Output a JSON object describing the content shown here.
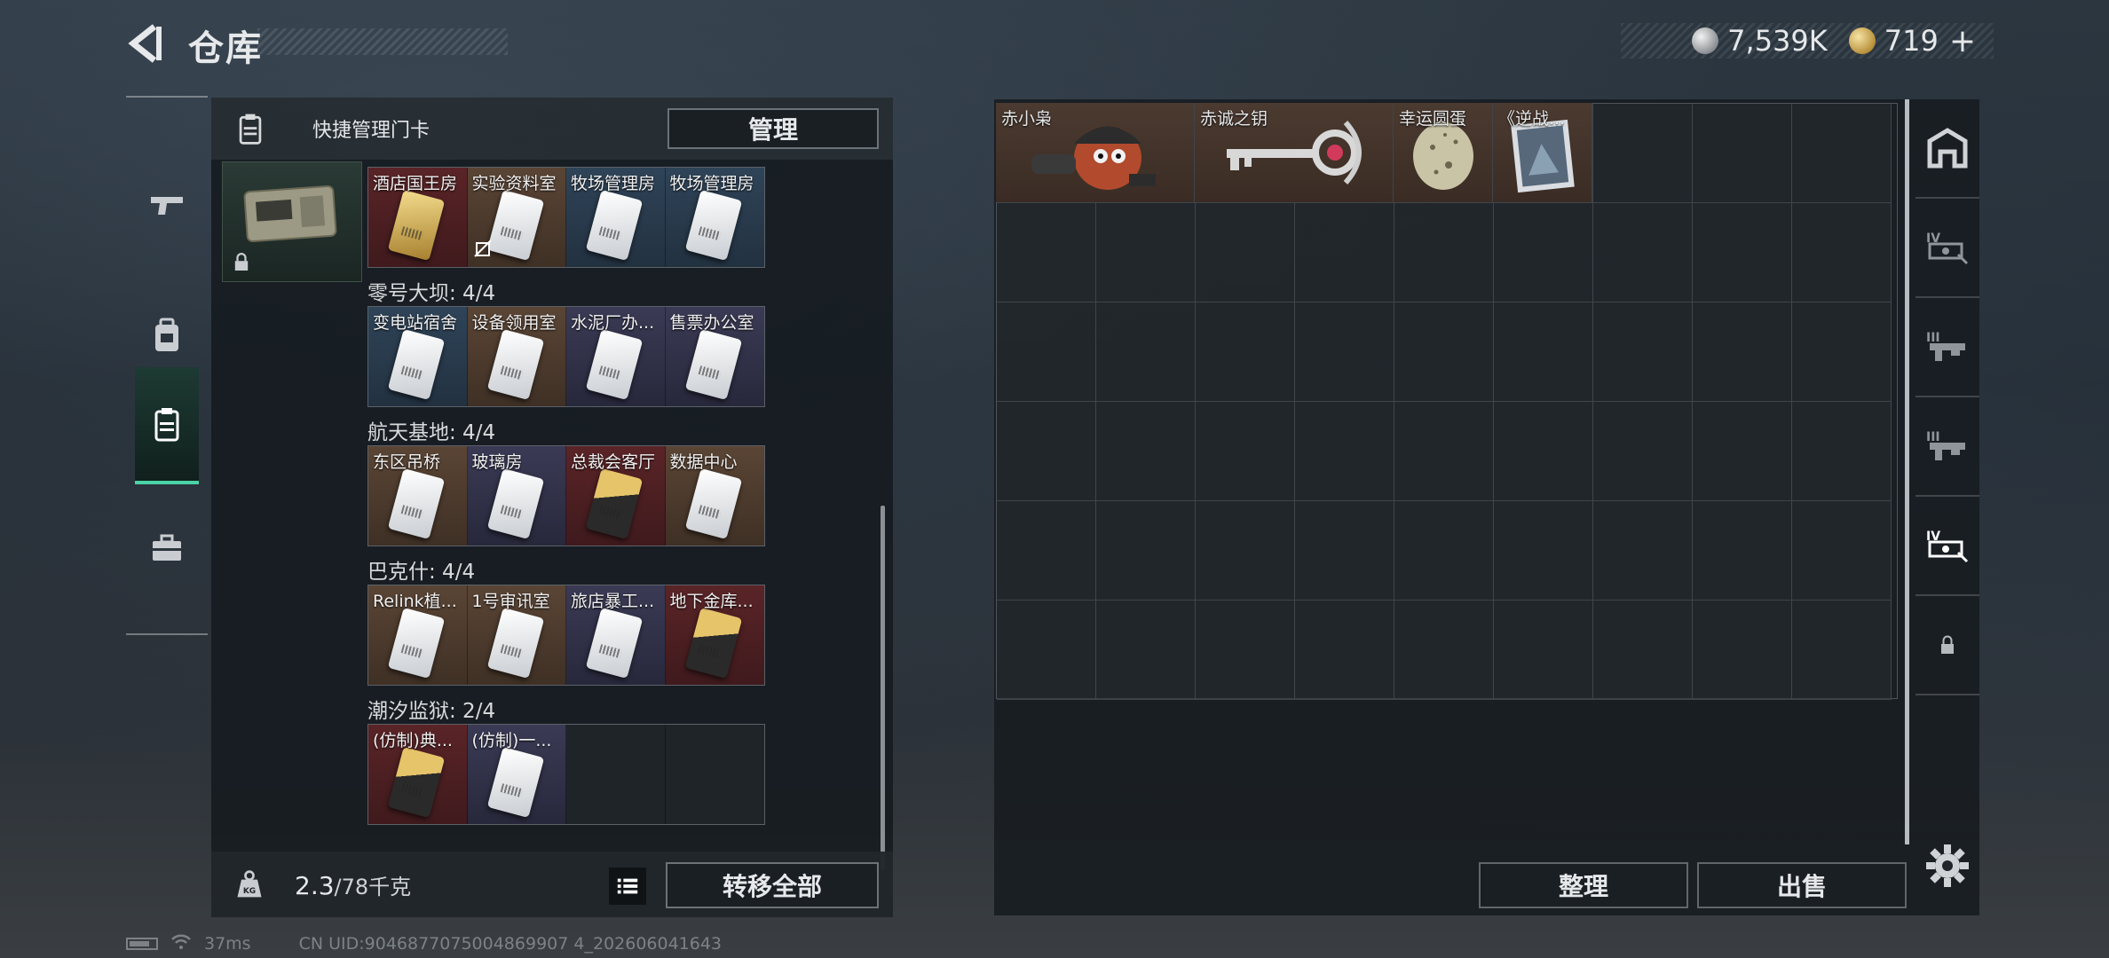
{
  "header": {
    "title": "仓库",
    "back_icon": "back-arrow-icon"
  },
  "currency": {
    "silver_amount": "7,539K",
    "gold_amount": "719",
    "plus": "+"
  },
  "left_tabs": [
    {
      "name": "weapons",
      "icon": "gun-icon",
      "active": false
    },
    {
      "name": "armor",
      "icon": "backpack-icon",
      "active": false
    },
    {
      "name": "keycards",
      "icon": "keycard-holder-icon",
      "active": true
    },
    {
      "name": "toolbox",
      "icon": "briefcase-icon",
      "active": false
    }
  ],
  "keypanel": {
    "header_label": "快捷管理门卡",
    "manage_label": "管理",
    "groups": [
      {
        "title": "",
        "cards": [
          {
            "name": "酒店国王房",
            "color": "red",
            "card": "gold",
            "nolink": false
          },
          {
            "name": "实验资料室",
            "color": "brown",
            "card": "white",
            "nolink": true
          },
          {
            "name": "牧场管理房",
            "color": "blue",
            "card": "white",
            "nolink": false
          },
          {
            "name": "牧场管理房",
            "color": "blue",
            "card": "white",
            "nolink": false
          }
        ]
      },
      {
        "title": "零号大坝: 4/4",
        "cards": [
          {
            "name": "变电站宿舍",
            "color": "blue",
            "card": "white",
            "nolink": false
          },
          {
            "name": "设备领用室",
            "color": "brown",
            "card": "white",
            "nolink": false
          },
          {
            "name": "水泥厂办...",
            "color": "purple",
            "card": "white",
            "nolink": false
          },
          {
            "name": "售票办公室",
            "color": "purple",
            "card": "white",
            "nolink": false
          }
        ]
      },
      {
        "title": "航天基地: 4/4",
        "cards": [
          {
            "name": "东区吊桥",
            "color": "brown",
            "card": "white",
            "nolink": false
          },
          {
            "name": "玻璃房",
            "color": "purple",
            "card": "white",
            "nolink": false
          },
          {
            "name": "总裁会客厅",
            "color": "red",
            "card": "blackgold",
            "nolink": false
          },
          {
            "name": "数据中心",
            "color": "brown",
            "card": "white",
            "nolink": false
          }
        ]
      },
      {
        "title": "巴克什: 4/4",
        "cards": [
          {
            "name": "Relink植...",
            "color": "brown",
            "card": "white",
            "nolink": false
          },
          {
            "name": "1号审讯室",
            "color": "brown",
            "card": "white",
            "nolink": false
          },
          {
            "name": "旅店暴工...",
            "color": "purple",
            "card": "white",
            "nolink": false
          },
          {
            "name": "地下金库...",
            "color": "red",
            "card": "blackgold",
            "nolink": false
          }
        ]
      },
      {
        "title": "潮汐监狱: 2/4",
        "cards": [
          {
            "name": "(仿制)典...",
            "color": "red",
            "card": "blackgold",
            "nolink": false
          },
          {
            "name": "(仿制)一...",
            "color": "purple",
            "card": "white",
            "nolink": false
          },
          {
            "name": "",
            "color": "empty",
            "card": "",
            "nolink": false
          },
          {
            "name": "",
            "color": "empty",
            "card": "",
            "nolink": false
          }
        ]
      }
    ],
    "weight_current": "2.3",
    "weight_max": "/78千克",
    "transfer_all_label": "转移全部"
  },
  "storage": {
    "items": [
      {
        "name": "赤小枭",
        "icon": "owl-figure-icon",
        "width_cells": 2
      },
      {
        "name": "赤诚之钥",
        "icon": "key-icon",
        "width_cells": 2
      },
      {
        "name": "幸运圆蛋",
        "icon": "egg-icon",
        "width_cells": 1
      },
      {
        "name": "《逆战...",
        "icon": "picture-card-icon",
        "width_cells": 1
      }
    ],
    "sort_label": "整理",
    "sell_label": "出售"
  },
  "right_tabs": [
    {
      "icon": "storage-box-icon"
    },
    {
      "icon": "tier-iv-gun-icon"
    },
    {
      "icon": "tier-iii-rifle-icon"
    },
    {
      "icon": "tier-iii-rifle-icon"
    },
    {
      "icon": "tier-iv-gun-icon"
    },
    {
      "icon": "lock-icon"
    }
  ],
  "status": {
    "ping": "37ms",
    "uid": "CN UID:9046877075004869907 4_202606041643"
  }
}
